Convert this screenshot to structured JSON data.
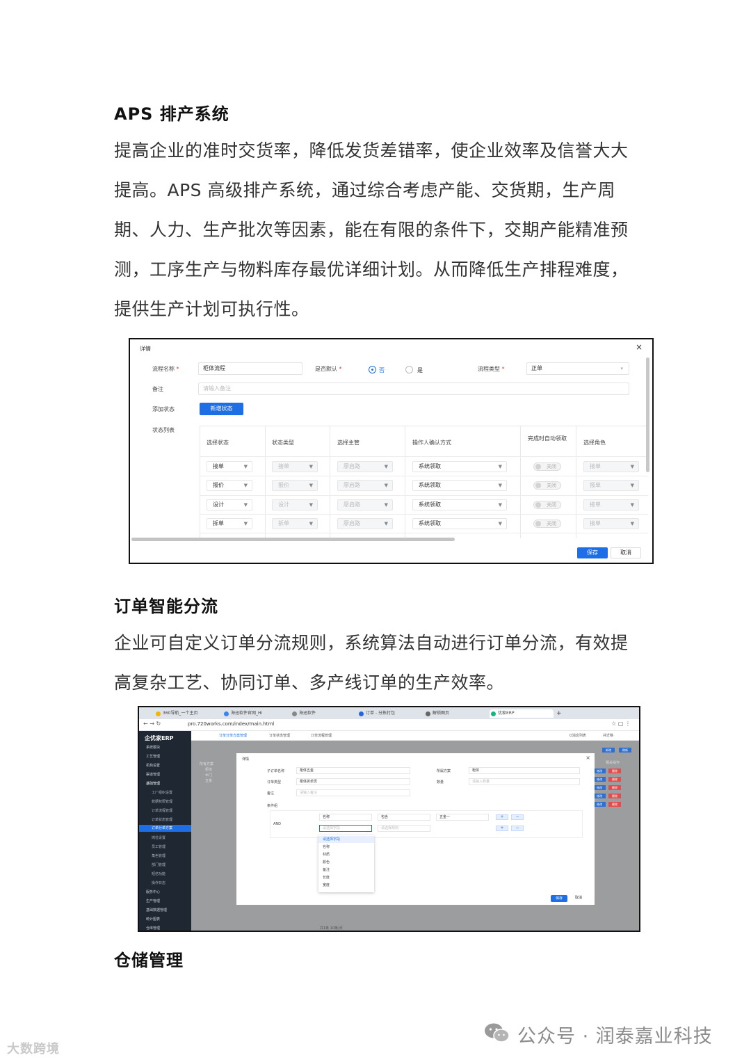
{
  "sections": [
    {
      "heading": "APS 排产系统",
      "paragraph": "提高企业的准时交货率，降低发货差错率，使企业效率及信誉大大提高。APS 高级排产系统，通过综合考虑产能、交货期，生产周期、人力、生产批次等因素，能在有限的条件下，交期产能精准预测，工序生产与物料库存最优详细计划。从而降低生产排程难度，提供生产计划可执行性。"
    },
    {
      "heading": "订单智能分流",
      "paragraph": "企业可自定义订单分流规则，系统算法自动进行订单分流，有效提高复杂工艺、协同订单、多产线订单的生产效率。"
    },
    {
      "heading": "仓储管理"
    }
  ],
  "shot1": {
    "title": "详情",
    "close": "×",
    "flow_name_label": "流程名称",
    "required_mark": "*",
    "flow_name_value": "柜体流程",
    "default_label": "是否默认",
    "radio_no": "否",
    "radio_yes": "是",
    "flow_type_label": "流程类型",
    "flow_type_value": "正单",
    "remark_label": "备注",
    "remark_placeholder": "请输入备注",
    "add_state_label": "添加状态",
    "add_state_button": "新增状态",
    "state_list_label": "状态列表",
    "columns": [
      "选择状态",
      "状态类型",
      "选择主管",
      "操作人确认方式",
      "完成时自动领取",
      "选择角色"
    ],
    "rows": [
      {
        "state": "接单",
        "type": "接单",
        "manager": "廖启路",
        "confirm": "系统领取",
        "toggle": "关闭",
        "role": "接单"
      },
      {
        "state": "报价",
        "type": "报价",
        "manager": "廖启路",
        "confirm": "系统领取",
        "toggle": "关闭",
        "role": "报单"
      },
      {
        "state": "设计",
        "type": "设计",
        "manager": "廖启路",
        "confirm": "系统领取",
        "toggle": "关闭",
        "role": "接单"
      },
      {
        "state": "拆单",
        "type": "拆单",
        "manager": "廖启路",
        "confirm": "系统领取",
        "toggle": "关闭",
        "role": "接单"
      }
    ],
    "save_button": "保存",
    "cancel_button": "取消"
  },
  "shot2": {
    "tabs": [
      "360导航_一个主页",
      "海迅软件官网_Hi",
      "海迅软件",
      "订单 - 分拣打包",
      "解锁图页",
      "优家ERP"
    ],
    "new_tab": "+",
    "url": "pro.720works.com/index/main.html",
    "logo": "企优家ERP",
    "menu": [
      "系统模块",
      "工艺管理",
      "机构设置",
      "渠道管理",
      "基础管理"
    ],
    "submenu": [
      "工厂组织设置",
      "数据权限管理",
      "订单流程管理",
      "订单状态管理",
      "订单分单方案",
      "岗位设置",
      "员工管理",
      "角色管理",
      "部门管理",
      "短信功能",
      "操作日志"
    ],
    "menu_bottom": [
      "服务中心",
      "生产管理",
      "基础数据管理",
      "统计图表",
      "仓库管理"
    ],
    "nav_tabs": [
      "订单分单方案管理",
      "订单状态管理",
      "订单流程管理"
    ],
    "nav_right": [
      "O消息列表",
      "共迁移"
    ],
    "tree": [
      "所有方案",
      "柜体",
      "木门",
      "五金"
    ],
    "top_buttons": [
      "新增",
      "刷新"
    ],
    "actions_header": "相关操作",
    "actions": [
      [
        "修改",
        "删除"
      ],
      [
        "修改",
        "删除"
      ],
      [
        "修改",
        "删除"
      ],
      [
        "修改",
        "删除"
      ],
      [
        "修改",
        "删除"
      ]
    ],
    "dialog_title": "详情",
    "dialog_close": "×",
    "fields": {
      "sub_order_label": "子订单名称",
      "sub_order_value": "柜体五金",
      "scheme_label": "所属方案",
      "scheme_value": "柜体",
      "type_label": "订单类型",
      "type_value": "柜体拆单页",
      "count_label": "数量",
      "count_value": "请输入数量",
      "remark_label": "备注",
      "remark_placeholder": "请输入备注",
      "cond_label": "条件组"
    },
    "cond": {
      "and_label": "AND",
      "f1": "名称",
      "op1": "包含",
      "v1": "五金一",
      "f2": "请选择字段",
      "op2": "请选择规则",
      "plus": "+",
      "minus": "−"
    },
    "dropdown": [
      "请选择字段",
      "名称",
      "材质",
      "颜色",
      "备注",
      "长度",
      "宽度"
    ],
    "save_button": "保存",
    "cancel_button": "取消",
    "pager": "共1条 10条/页"
  },
  "watermark_left": "大数跨境",
  "watermark_right": "公众号 · 润泰嘉业科技"
}
